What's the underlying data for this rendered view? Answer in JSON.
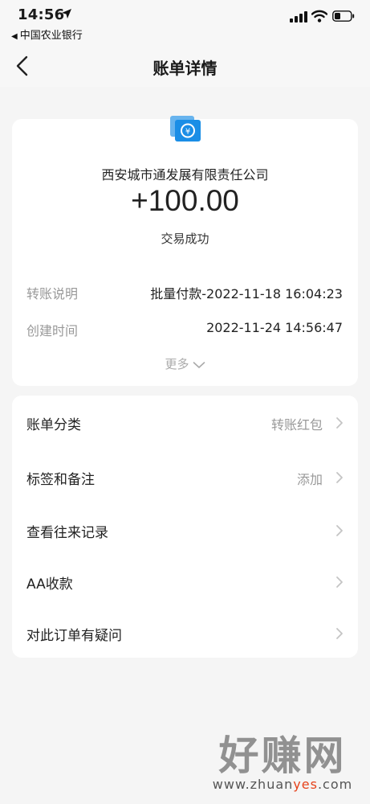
{
  "status_bar": {
    "time": "14:56",
    "back_app": "中国农业银行"
  },
  "nav": {
    "title": "账单详情"
  },
  "transaction": {
    "merchant": "西安城市通发展有限责任公司",
    "amount": "+100.00",
    "status": "交易成功",
    "details": [
      {
        "label": "转账说明",
        "value": "批量付款-2022-11-18 16:04:23"
      },
      {
        "label": "创建时间",
        "value": "2022-11-24 14:56:47"
      }
    ],
    "more_label": "更多"
  },
  "menu": [
    {
      "label": "账单分类",
      "value": "转账红包"
    },
    {
      "label": "标签和备注",
      "value": "添加"
    },
    {
      "label": "查看往来记录",
      "value": ""
    },
    {
      "label": "AA收款",
      "value": ""
    },
    {
      "label": "对此订单有疑问",
      "value": ""
    }
  ],
  "watermark": {
    "title": "好赚网",
    "url_prefix": "www.zhuan",
    "url_accent": "yes",
    "url_suffix": ".com"
  },
  "colors": {
    "background": "#f5f5f5",
    "card": "#ffffff",
    "logo_blue": "#1a8ee6",
    "muted_text": "#999999",
    "watermark_accent": "#e6421a"
  }
}
